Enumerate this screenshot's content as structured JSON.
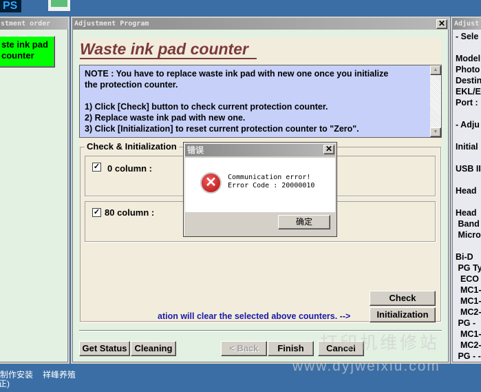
{
  "desktop": {
    "icon1_label": "PS",
    "taskbar_labels": [
      "制作安装",
      "祥峰养殖"
    ],
    "taskbar_sub": "(正)"
  },
  "left_window": {
    "title": "stment order",
    "button_label": "ste ink pad\ncounter",
    "accent": "#00ff00"
  },
  "main_window": {
    "title": "Adjustment Program",
    "heading": "Waste ink pad counter",
    "note_lines": [
      "NOTE : You have to replace waste ink pad with new one once you initialize",
      "the protection counter.",
      "",
      "1) Click [Check] button to check current protection counter.",
      "2) Replace waste ink pad with new one.",
      "3) Click [Initialization] to reset current protection counter to \"Zero\"."
    ],
    "group_title": "Check & Initialization",
    "counters": [
      {
        "label": "0 column :",
        "checked": true
      },
      {
        "label": "80 column :",
        "checked": true
      }
    ],
    "hint": "ation will clear the selected above counters. -->",
    "check_label": "Check",
    "init_label": "Initialization",
    "buttons": {
      "get_status": "Get Status",
      "cleaning": "Cleaning",
      "back": "< Back",
      "finish": "Finish",
      "cancel": "Cancel"
    }
  },
  "right_window": {
    "title": "Adjust",
    "lines": [
      "- Sele",
      "",
      "Model",
      "Photo",
      "Destin",
      "EKL/E",
      "Port :",
      "",
      "- Adju",
      "",
      "Initial",
      "",
      "USB II",
      "",
      "Head",
      "",
      "Head",
      " Band",
      " Micro",
      "",
      "Bi-D",
      " PG Ty",
      "  ECO",
      "  MC1-",
      "  MC1-",
      "  MC2-",
      " PG -",
      "  MC1-",
      "  MC2-",
      " PG - -"
    ]
  },
  "dialog": {
    "title": "错误",
    "message_line1": "Communication error!",
    "message_line2": "Error Code : 20000010",
    "ok_label": "确定",
    "icon": "error-icon"
  },
  "watermark": {
    "line1": "打印机维修站",
    "line2": "www.dyjweixiu.com"
  }
}
